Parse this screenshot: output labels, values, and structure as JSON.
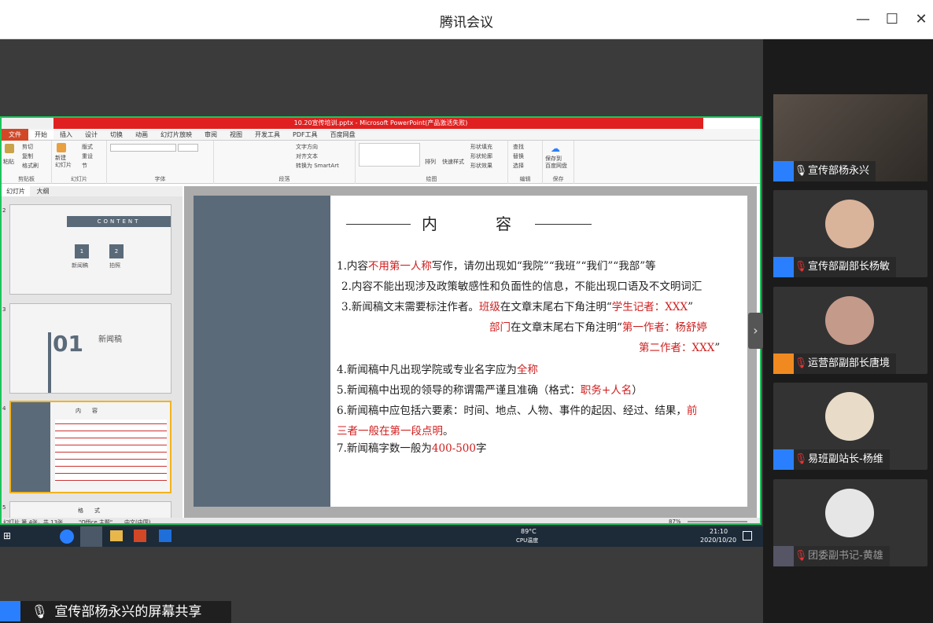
{
  "window": {
    "title": "腾讯会议",
    "min": "—",
    "max": "☐",
    "close": "✕"
  },
  "ppt": {
    "title": "10.20宣传培训.pptx - Microsoft PowerPoint(产品激活失败)",
    "tabs": [
      "文件",
      "开始",
      "插入",
      "设计",
      "切换",
      "动画",
      "幻灯片放映",
      "审阅",
      "视图",
      "开发工具",
      "PDF工具",
      "百度网盘"
    ],
    "ribbon": {
      "clipboard": {
        "label": "剪贴板",
        "paste": "粘贴",
        "cut": "剪切",
        "copy": "复制",
        "painter": "格式刷"
      },
      "slides": {
        "label": "幻灯片",
        "new": "新建\n幻灯片",
        "layout": "版式",
        "reset": "重设",
        "section": "节"
      },
      "font": {
        "label": "字体"
      },
      "paragraph": {
        "label": "段落",
        "dir": "文字方向",
        "align": "对齐文本",
        "smartart": "转换为 SmartArt"
      },
      "drawing": {
        "label": "绘图",
        "arrange": "排列",
        "styles": "快速样式",
        "fill": "形状填充",
        "outline": "形状轮廓",
        "effect": "形状效果"
      },
      "edit": {
        "label": "编辑",
        "find": "查找",
        "replace": "替换",
        "select": "选择"
      },
      "save": {
        "label": "保存",
        "baidu": "保存到\n百度网盘"
      }
    },
    "pane_tabs": [
      "幻灯片",
      "大纲"
    ],
    "thumbs": {
      "t2_content": "CONTENT",
      "t2_a": "新闻稿",
      "t2_b": "拍照",
      "t2_n1": "1",
      "t2_n2": "2",
      "t3_num": "01",
      "t3_text": "新闻稿",
      "t4_title": "内　　容",
      "t5_title": "格　　式"
    },
    "slide": {
      "title_a": "内",
      "title_b": "容",
      "l1a": "1.内容",
      "l1b": "不用第一人称",
      "l1c": "写作，请勿出现如“我院”“我班”“我们”“我部”等",
      "l2": "2.内容不能出现涉及政策敏感性和负面性的信息，不能出现口语及不文明词汇",
      "l3a": "3.新闻稿文末需要标注作者。",
      "l3b": "班级",
      "l3c": "在文章末尾右下角注明“",
      "l3d": "学生记者：XXX",
      "l3e": "”",
      "l4a": "部门",
      "l4b": "在文章末尾右下角注明“",
      "l4c": "第一作者：杨舒婷",
      "l5a": "第二作者：XXX",
      "l5b": "”",
      "l6a": "4.新闻稿中凡出现学院或专业名字应为",
      "l6b": "全称",
      "l7a": "5.新闻稿中出现的领导的称谓需严谨且准确（格式：",
      "l7b": "职务+人名",
      "l7c": "）",
      "l8a": "6.新闻稿中应包括六要素：时间、地点、人物、事件的起因、经过、结果，",
      "l8b": "前",
      "l9a": "三者一般在第一段点明",
      "l9b": "。",
      "l10a": "7.新闻稿字数一般为",
      "l10b": "400-500",
      "l10c": "字"
    },
    "status": {
      "slide": "幻灯片 第 4张，共 13张",
      "theme": "\"Office 主题\"",
      "lang": "中文(中国)",
      "zoom": "87%"
    }
  },
  "taskbar": {
    "cpu_temp": "89°C",
    "cpu_label": "CPU温度",
    "time": "21:10",
    "date": "2020/10/20"
  },
  "share_label": "宣传部杨永兴的屏幕共享",
  "participants": [
    {
      "name": "宣传部杨永兴",
      "muted": false
    },
    {
      "name": "宣传部副部长杨敏",
      "muted": true
    },
    {
      "name": "运营部副部长唐境",
      "muted": true
    },
    {
      "name": "易班副站长-杨维",
      "muted": true
    },
    {
      "name": "团委副书记-黄雄",
      "muted": true
    }
  ],
  "colors": {
    "accent": "#1ec45c",
    "ppt_red": "#e02020",
    "slide_band": "#5a6a79",
    "text_red": "#d02020",
    "user_blue": "#2a7fff"
  }
}
